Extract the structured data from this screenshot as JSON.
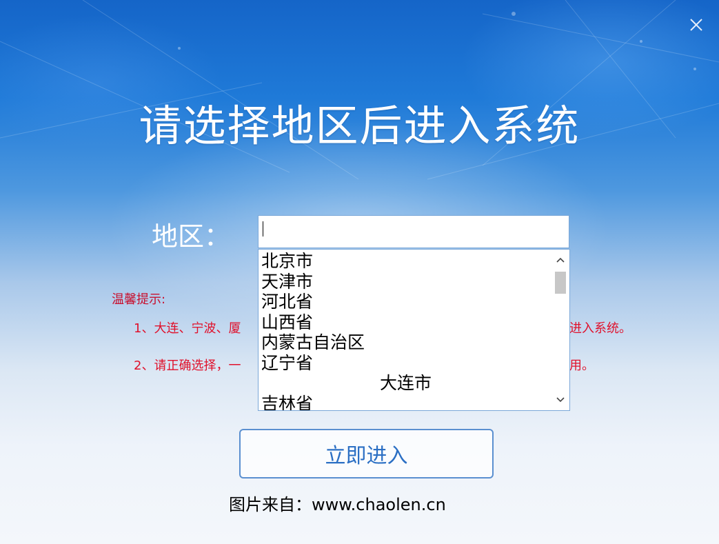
{
  "window": {
    "close_icon": "close-icon",
    "title": "请选择地区后进入系统"
  },
  "region": {
    "label": "地区：",
    "input_value": "",
    "options": [
      "北京市",
      "天津市",
      "河北省",
      "山西省",
      "内蒙古自治区",
      "辽宁省",
      "大连市",
      "吉林省"
    ]
  },
  "tips": {
    "title": "温馨提示:",
    "line1_start": "1、大连、宁波、厦",
    "line1_end": "进入系统。",
    "line2_start": "2、请正确选择，一",
    "line2_end": "用。"
  },
  "enter_button": {
    "label": "立即进入"
  },
  "footer": {
    "source": "图片来自：www.chaolen.cn"
  },
  "colors": {
    "tip_red": "#e0102a",
    "button_text": "#2b6fc4",
    "accent_blue": "#1565c8"
  }
}
